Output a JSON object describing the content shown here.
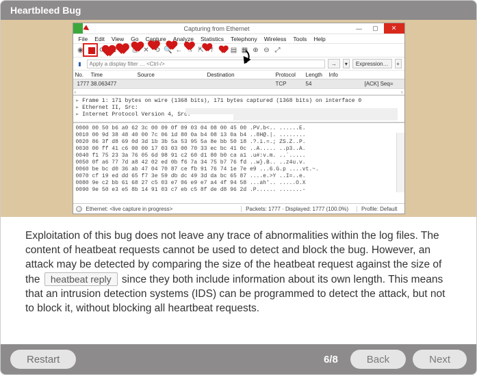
{
  "card": {
    "title": "Heartbleed Bug",
    "paragraph_parts": {
      "p1": "Exploitation of this bug does not leave any trace of abnormalities within the log files. The content of heatbeat requests cannot be used to detect and block the bug. However, an attack may be detected by comparing the size of the heatbeat request against the size of the ",
      "blank": "heatbeat reply",
      "p2": " since they both include information about its own length. This means that an intrusion detection systems (IDS) can be programmed to detect the attack, but not to block it, without blocking all heartbeat requests."
    }
  },
  "window": {
    "title": "Capturing from Ethernet",
    "win_buttons": {
      "min": "—",
      "max": "▢",
      "close": "✕"
    },
    "menu": [
      "File",
      "Edit",
      "View",
      "Go",
      "Capture",
      "Analyze",
      "Statistics",
      "Telephony",
      "Wireless",
      "Tools",
      "Help"
    ],
    "filter_placeholder": "Apply a display filter … <Ctrl-/>",
    "go_arrow": "→",
    "expression_label": "Expression…",
    "list_headers": {
      "no": "No.",
      "time": "Time",
      "source": "Source",
      "destination": "Destination",
      "protocol": "Protocol",
      "length": "Length",
      "info": "Info"
    },
    "rows": [
      {
        "no": "1777",
        "time": "38.063477",
        "source": "",
        "destination": "",
        "protocol": "TCP",
        "length": "54",
        "info": "[ACK] Seq="
      }
    ],
    "scroll_arrows": {
      "left": "‹",
      "right": "›",
      "up": "˄",
      "down": "˅"
    },
    "details": {
      "l1": "▹ Frame 1: 171 bytes on wire (1368 bits), 171 bytes captured (1368 bits) on interface 0",
      "l2": "▹ Ethernet II, Src:",
      "l3": "▹ Internet Protocol Version 4, Src:"
    },
    "hex_lines": [
      "0000   00 50 b6 a0 62 3c 00 09  0f 09 03 04 08 00 45 00   .PV.b<.. ......E.",
      "0010   00 9d 38 48 40 00 7c 06  1d 80 0a b4 08 13 0a b4   ..8H@.|. ........",
      "0020   86 3f d8 69 0d 3d 1b 3b  5a 53 95 5a 8e bb 50 18   .?.i.=.; ZS.Z..P.",
      "0030   00 ff 41 c6 00 00 17 03  03 00 70 33 ec bc 41 0c   ..A..... ..p3..A.",
      "0040   f1 75 23 3a 76 05 6d 98  91 c2 60 d1 80 b0 ca a1   .u#:v.m. ..`.....",
      "0050   0f a6 77 7d a8 42 02 ed  0b f6 7a 34 75 b7 76 fd   ..w}.B.. ..z4u.v.",
      "0060   be bc d0 36 ab 47 04 70  87 ce fb 91 76 74 1e 7e e9   ...6.G.p ....vt.~.",
      "0070   cf 19 ed dd 65 f7 3e 59  db dc 49 3d da bc 65 87   ....e.>Y ..I=..e.",
      "0080   9e c2 bb 61 68 27 c5 03  e7 06 e9 e7 a4 4f 94 58   ...ah'.. .....O.X",
      "0090   9e 50 e3 e5 8b 14 91 03  c7 eb c5 8f de d8 96 2d   .P...... .......-"
    ],
    "status": {
      "left": "Ethernet: <live capture in progress>",
      "packets": "Packets: 1777 · Displayed: 1777 (100.0%)",
      "profile": "Profile: Default"
    }
  },
  "footer": {
    "restart": "Restart",
    "page": "6/8",
    "back": "Back",
    "next": "Next"
  }
}
